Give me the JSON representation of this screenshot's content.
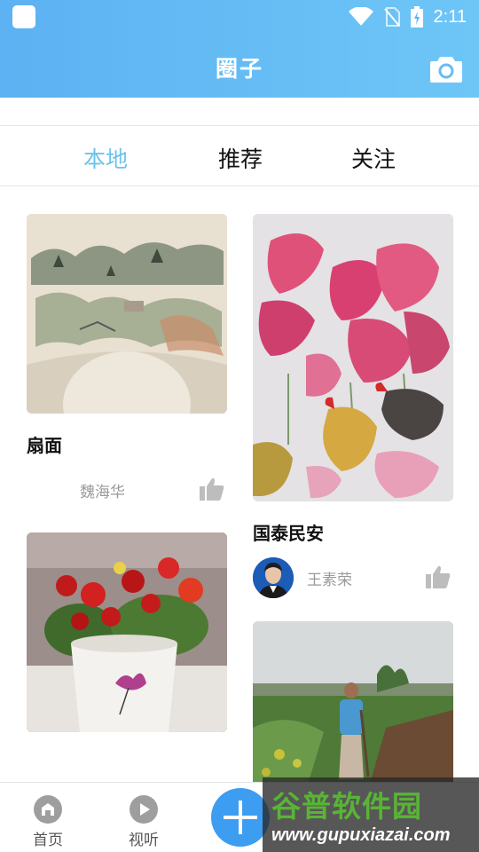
{
  "status_bar": {
    "time": "2:11"
  },
  "header": {
    "title": "圈子",
    "camera_icon": "camera-icon"
  },
  "tabs": [
    {
      "label": "本地",
      "active": true
    },
    {
      "label": "推荐",
      "active": false
    },
    {
      "label": "关注",
      "active": false
    }
  ],
  "feed": {
    "left": [
      {
        "title": "扇面",
        "author": "魏海华",
        "has_avatar": false,
        "image": "landscape-fan-painting"
      },
      {
        "title": "",
        "author": "",
        "image": "red-begonia-flower-pot"
      }
    ],
    "right": [
      {
        "title": "国泰民安",
        "author": "王素荣",
        "has_avatar": true,
        "image": "roosters-and-red-amaranth-painting"
      },
      {
        "title": "",
        "author": "",
        "image": "man-working-in-field"
      }
    ]
  },
  "bottom_nav": [
    {
      "label": "首页",
      "icon": "home-icon"
    },
    {
      "label": "视听",
      "icon": "play-icon"
    }
  ],
  "fab": {
    "icon": "plus-icon"
  },
  "watermark": {
    "logo": "谷普软件园",
    "url": "www.gupuxiazai.com"
  },
  "colors": {
    "header": "#5cb2f2",
    "active_tab": "#6cc3ea",
    "fab": "#3d9df0"
  }
}
